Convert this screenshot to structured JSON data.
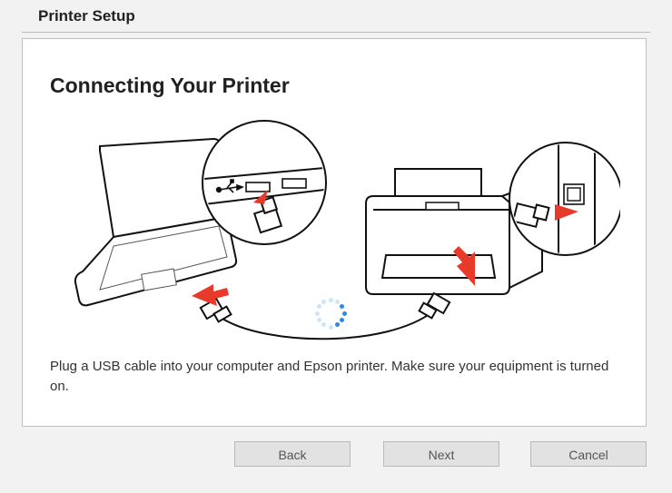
{
  "window": {
    "title": "Printer Setup"
  },
  "page": {
    "heading": "Connecting Your Printer",
    "instruction": "Plug a USB cable into your computer and Epson printer. Make sure your equipment is turned on."
  },
  "buttons": {
    "back": "Back",
    "next": "Next",
    "cancel": "Cancel"
  },
  "illustration": {
    "description": "Line drawing of a laptop on the left and a printer on the right connected by a USB cable, with two circular close-ups showing the USB ports.",
    "icons": [
      "laptop-icon",
      "printer-icon",
      "usb-cable-icon",
      "zoom-circle-icon",
      "arrow-icon"
    ]
  },
  "spinner": {
    "color_bright": "#2a8bdf",
    "color_faint": "#cde6f7",
    "dots": 12
  }
}
